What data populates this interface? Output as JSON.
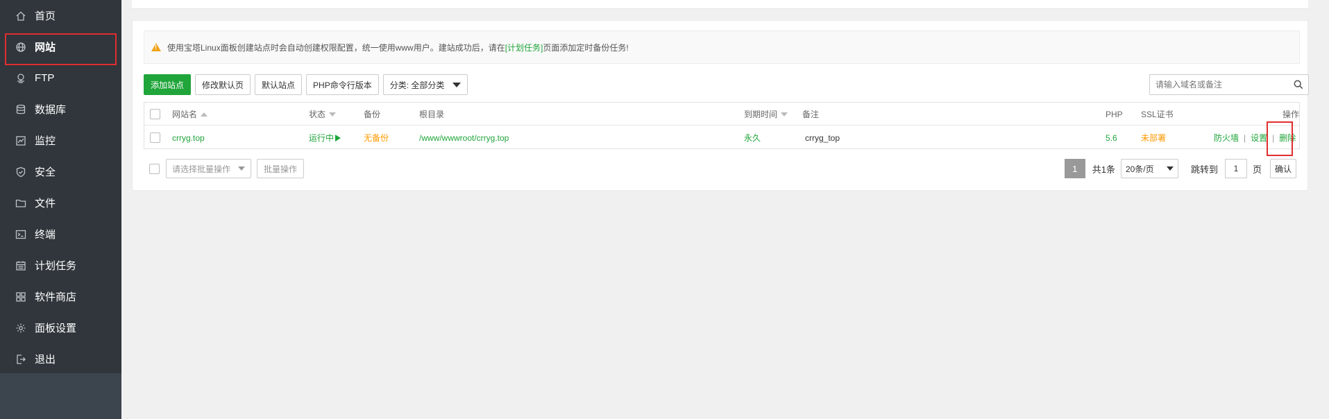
{
  "sidebar": {
    "items": [
      {
        "label": "首页",
        "icon": "home-icon"
      },
      {
        "label": "网站",
        "icon": "globe-icon"
      },
      {
        "label": "FTP",
        "icon": "ftp-icon"
      },
      {
        "label": "数据库",
        "icon": "database-icon"
      },
      {
        "label": "监控",
        "icon": "monitor-icon"
      },
      {
        "label": "安全",
        "icon": "shield-icon"
      },
      {
        "label": "文件",
        "icon": "folder-icon"
      },
      {
        "label": "终端",
        "icon": "terminal-icon"
      },
      {
        "label": "计划任务",
        "icon": "calendar-icon"
      },
      {
        "label": "软件商店",
        "icon": "apps-icon"
      },
      {
        "label": "面板设置",
        "icon": "gear-icon"
      },
      {
        "label": "退出",
        "icon": "logout-icon"
      }
    ],
    "active_index": 1
  },
  "notice": {
    "text_before": "使用宝塔Linux面板创建站点时会自动创建权限配置，统一使用www用户。建站成功后，请在",
    "link": "[计划任务]",
    "text_after": "页面添加定时备份任务!"
  },
  "toolbar": {
    "add_site": "添加站点",
    "edit_default_page": "修改默认页",
    "default_site": "默认站点",
    "php_cli": "PHP命令行版本",
    "category": "分类: 全部分类"
  },
  "search": {
    "placeholder": "请输入域名或备注"
  },
  "table": {
    "headers": {
      "name": "网站名",
      "status": "状态",
      "backup": "备份",
      "root": "根目录",
      "expire": "到期时间",
      "remark": "备注",
      "php": "PHP",
      "ssl": "SSL证书",
      "action": "操作"
    },
    "rows": [
      {
        "name": "crryg.top",
        "status": "运行中",
        "backup": "无备份",
        "root": "/www/wwwroot/crryg.top",
        "expire": "永久",
        "remark": "crryg_top",
        "php": "5.6",
        "ssl": "未部署",
        "firewall": "防火墙",
        "settings": "设置",
        "delete": "删除"
      }
    ]
  },
  "bottom": {
    "batch_select_placeholder": "请选择批量操作",
    "batch_button": "批量操作"
  },
  "pager": {
    "current": "1",
    "total": "共1条",
    "per_page": "20条/页",
    "jump_label": "跳转到",
    "jump_value": "1",
    "page_unit": "页",
    "confirm": "确认"
  },
  "colors": {
    "brand_green": "#20a53a",
    "warning_orange": "#ff9900",
    "sidebar_bg": "#30363c",
    "highlight_red": "#e02e2e"
  }
}
